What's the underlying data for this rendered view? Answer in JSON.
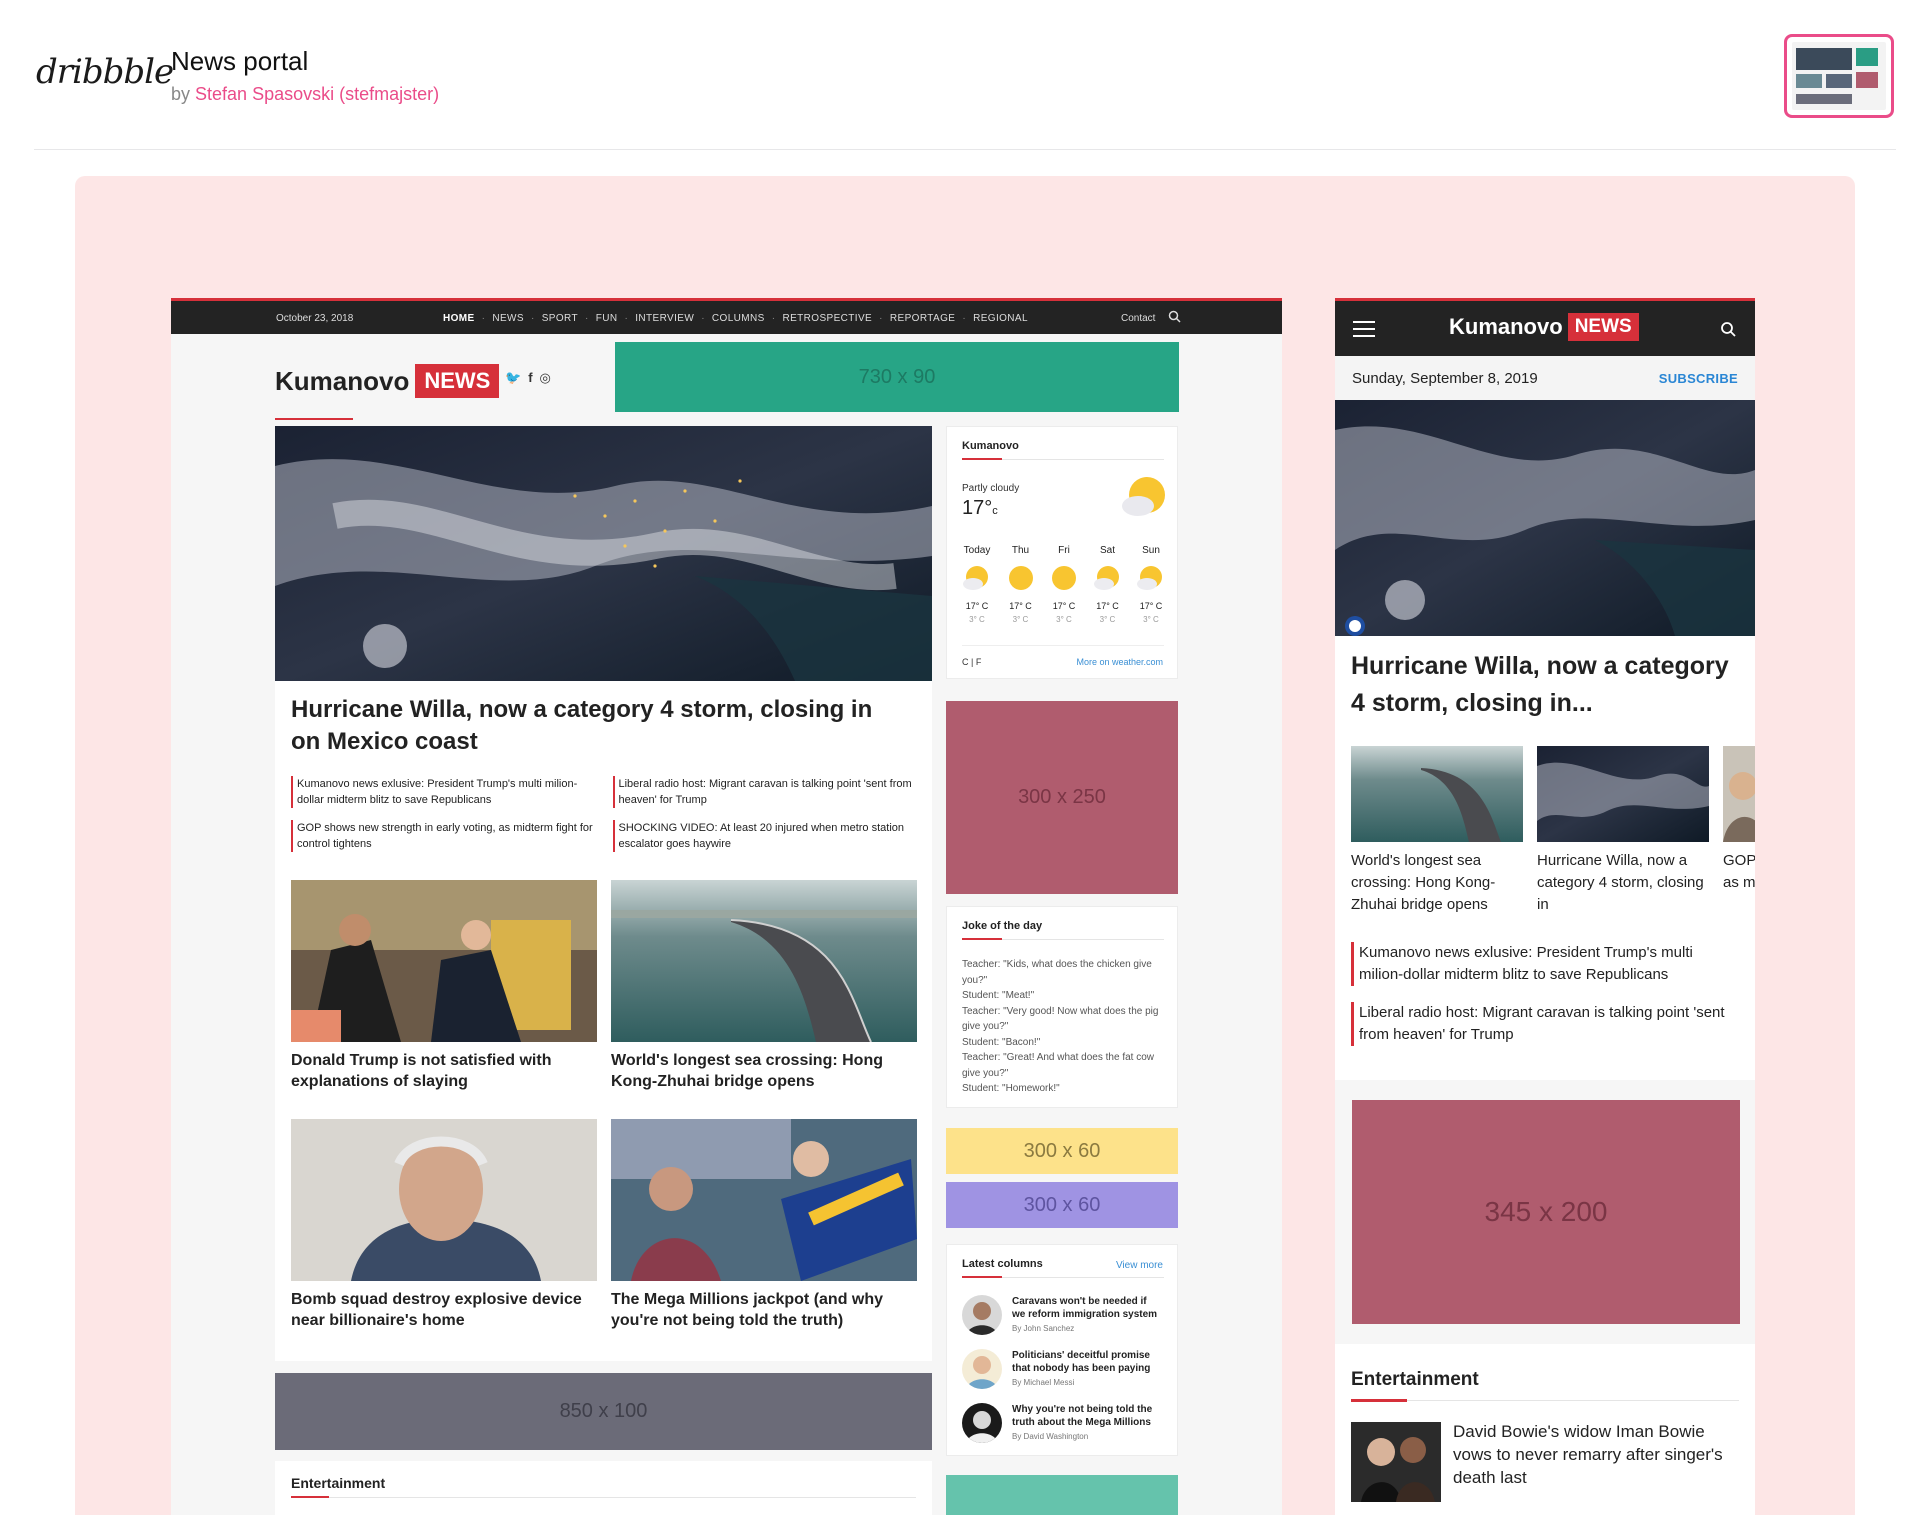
{
  "header": {
    "logo": "dribbble",
    "title": "News portal",
    "by_prefix": "by",
    "author": "Stefan Spasovski (stefmajster)"
  },
  "desktop": {
    "date": "October 23, 2018",
    "menu": [
      "HOME",
      "NEWS",
      "SPORT",
      "FUN",
      "INTERVIEW",
      "COLUMNS",
      "RETROSPECTIVE",
      "REPORTAGE",
      "REGIONAL"
    ],
    "contact": "Contact",
    "brand_name": "Kumanovo",
    "brand_badge": "NEWS",
    "ads": {
      "top": "730 x 90",
      "medium": "300 x 250",
      "small_a": "300 x 60",
      "small_b": "300 x 60",
      "leaderboard": "850 x 100"
    },
    "hero_title": "Hurricane Willa, now a category 4 storm, closing in on Mexico coast",
    "bullets": [
      "Kumanovo news exlusive: President Trump's multi milion-dollar midterm blitz to save Republicans",
      "Liberal radio host: Migrant caravan is talking point 'sent from heaven' for Trump",
      "GOP shows new strength in early voting, as midterm fight for control tightens",
      "SHOCKING VIDEO: At least 20 injured when metro station escalator goes haywire"
    ],
    "tiles": [
      "Donald Trump is not satisfied with explanations of slaying",
      "World's longest sea crossing: Hong Kong-Zhuhai bridge opens",
      "Bomb squad destroy explosive device near billionaire's home",
      "The Mega Millions jackpot (and why you're not being told the truth)"
    ],
    "weather": {
      "city": "Kumanovo",
      "condition": "Partly cloudy",
      "temp": "17°",
      "unit": "c",
      "days": [
        {
          "name": "Today",
          "hi": "17° C",
          "lo": "3° C",
          "icon": "partly-cloudy-icon"
        },
        {
          "name": "Thu",
          "hi": "17° C",
          "lo": "3° C",
          "icon": "sun-icon"
        },
        {
          "name": "Fri",
          "hi": "17° C",
          "lo": "3° C",
          "icon": "sun-icon"
        },
        {
          "name": "Sat",
          "hi": "17° C",
          "lo": "3° C",
          "icon": "partly-cloudy-icon"
        },
        {
          "name": "Sun",
          "hi": "17° C",
          "lo": "3° C",
          "icon": "partly-cloudy-icon"
        }
      ],
      "units": "C | F",
      "more": "More on weather.com"
    },
    "joke": {
      "title": "Joke of the day",
      "text": "Teacher: \"Kids, what does the chicken give you?\"\nStudent: \"Meat!\"\nTeacher: \"Very good! Now what does the pig give you?\"\nStudent: \"Bacon!\"\nTeacher: \"Great! And what does the fat cow give you?\"\nStudent: \"Homework!\""
    },
    "columns": {
      "title": "Latest columns",
      "more": "View more",
      "items": [
        {
          "title": "Caravans won't be needed if we reform immigration system",
          "author": "By John Sanchez"
        },
        {
          "title": "Politicians' deceitful promise that nobody has been paying",
          "author": "By Michael Messi"
        },
        {
          "title": "Why you're not being told the truth about the Mega Millions",
          "author": "By David Washington"
        }
      ]
    },
    "entertainment": "Entertainment"
  },
  "mobile": {
    "brand_name": "Kumanovo",
    "brand_badge": "NEWS",
    "date": "Sunday, September 8, 2019",
    "subscribe": "SUBSCRIBE",
    "hero_title": "Hurricane Willa, now a category 4 storm, closing in...",
    "tiles": [
      "World's longest sea crossing: Hong Kong-Zhuhai bridge opens",
      "Hurricane Willa, now a category 4 storm, closing in",
      "GOP shows new strength as m"
    ],
    "bullets": [
      "Kumanovo news exlusive: President Trump's multi milion-dollar midterm blitz to save Republicans",
      "Liberal radio host: Migrant caravan is talking point 'sent from heaven' for Trump"
    ],
    "ad": "345 x 200",
    "entertainment": "Entertainment",
    "ent_story": "David Bowie's widow Iman Bowie vows to never remarry after singer's death last"
  },
  "colors": {
    "accent_red": "#d6303a",
    "brand_pink": "#ea4c89",
    "canvas_bg": "#fde6e6",
    "nav_dark": "#232323",
    "link_blue": "#3a8fd4"
  }
}
